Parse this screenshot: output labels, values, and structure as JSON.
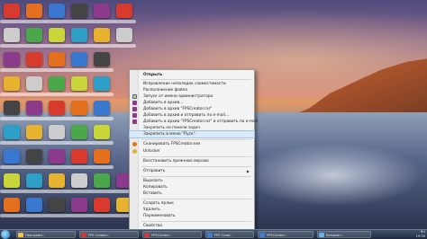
{
  "context_menu": {
    "items": [
      {
        "label": "Открыть",
        "bold": true
      },
      {
        "label": "Исправление неполадок совместимости"
      },
      {
        "label": "Расположение файла"
      },
      {
        "label": "Запуск от имени администратора"
      },
      {
        "label": "Добавить в архив..."
      },
      {
        "label": "Добавить в архив \"FPSCreator.rar\""
      },
      {
        "label": "Добавить в архив и отправить по e-mail..."
      },
      {
        "label": "Добавить в архив \"FPSCreator.rar\" и отправить по e-mail"
      },
      {
        "label": "Закрепить на панели задач"
      },
      {
        "label": "Закрепить в меню \"Пуск\""
      },
      {
        "label": "Сканировать FPSCreator.exe"
      },
      {
        "label": "Unlocker"
      },
      {
        "label": "Восстановить прежнюю версию"
      },
      {
        "label": "Отправить"
      },
      {
        "label": "Вырезать"
      },
      {
        "label": "Копировать"
      },
      {
        "label": "Вставить"
      },
      {
        "label": "Создать ярлык"
      },
      {
        "label": "Удалить"
      },
      {
        "label": "Переименовать"
      },
      {
        "label": "Свойства"
      }
    ]
  },
  "taskbar": {
    "buttons": [
      {
        "label": "Программ..."
      },
      {
        "label": "FPS Creator..."
      },
      {
        "label": "FPSCreator..."
      },
      {
        "label": "FPS Creat..."
      },
      {
        "label": "FPSCreator..."
      },
      {
        "label": "Безымян..."
      }
    ],
    "clock": "19:35",
    "lang": "RU"
  },
  "colors": {
    "menu_bg": "#f3f3f3",
    "highlight": "#dce9f7",
    "taskbar": "#1f2a3d"
  }
}
